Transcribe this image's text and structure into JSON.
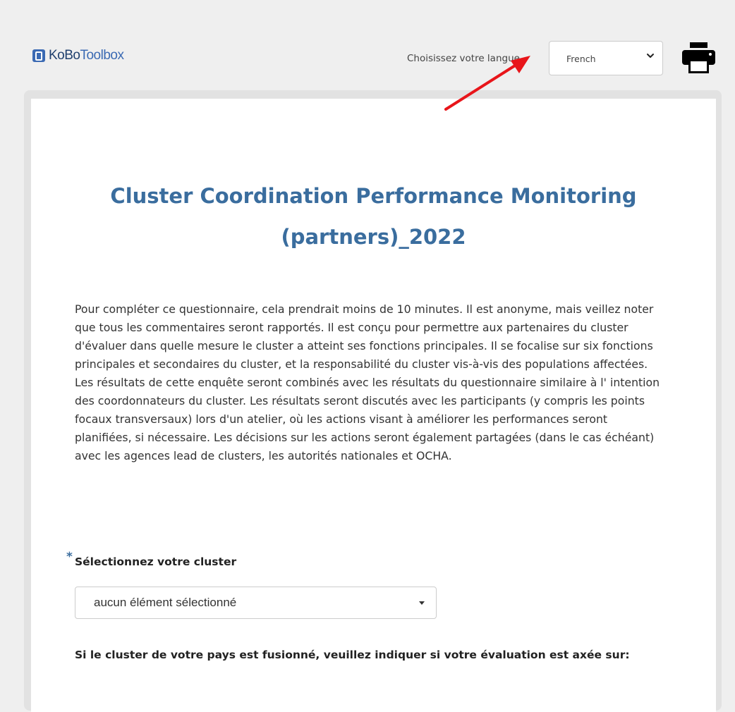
{
  "header": {
    "logo_part1": "KoBo",
    "logo_part2": "Toolbox",
    "language_label": "Choisissez votre langue",
    "language_selected": "French"
  },
  "form": {
    "title": "Cluster Coordination Performance Monitoring (partners)_2022",
    "intro": "Pour compléter ce questionnaire, cela prendrait moins de 10 minutes. Il est anonyme, mais veillez noter que tous les commentaires seront rapportés. Il est conçu pour permettre aux partenaires du cluster d'évaluer dans quelle mesure le cluster a atteint ses fonctions principales. Il se focalise sur six fonctions principales et secondaires du cluster, et la responsabilité du cluster vis-à-vis des populations affectées. Les résultats de cette enquête seront combinés avec les résultats du questionnaire similaire à l' intention des coordonnateurs du cluster. Les résultats seront discutés avec les participants (y compris les points focaux transversaux) lors d'un atelier, où les actions visant à améliorer les performances seront planifiées, si nécessaire. Les décisions sur les actions seront également partagées (dans le cas échéant) avec les agences lead de clusters, les autorités nationales et OCHA.",
    "questions": [
      {
        "required_marker": "*",
        "label": "Sélectionnez votre cluster",
        "selected_value": "aucun élément sélectionné"
      },
      {
        "label": "Si le cluster de votre pays est fusionné, veuillez indiquer si votre évaluation est axée sur:"
      }
    ]
  },
  "colors": {
    "accent": "#3a6d9e",
    "logo": "#3b6ab3",
    "annotation_arrow": "#e8151a"
  }
}
